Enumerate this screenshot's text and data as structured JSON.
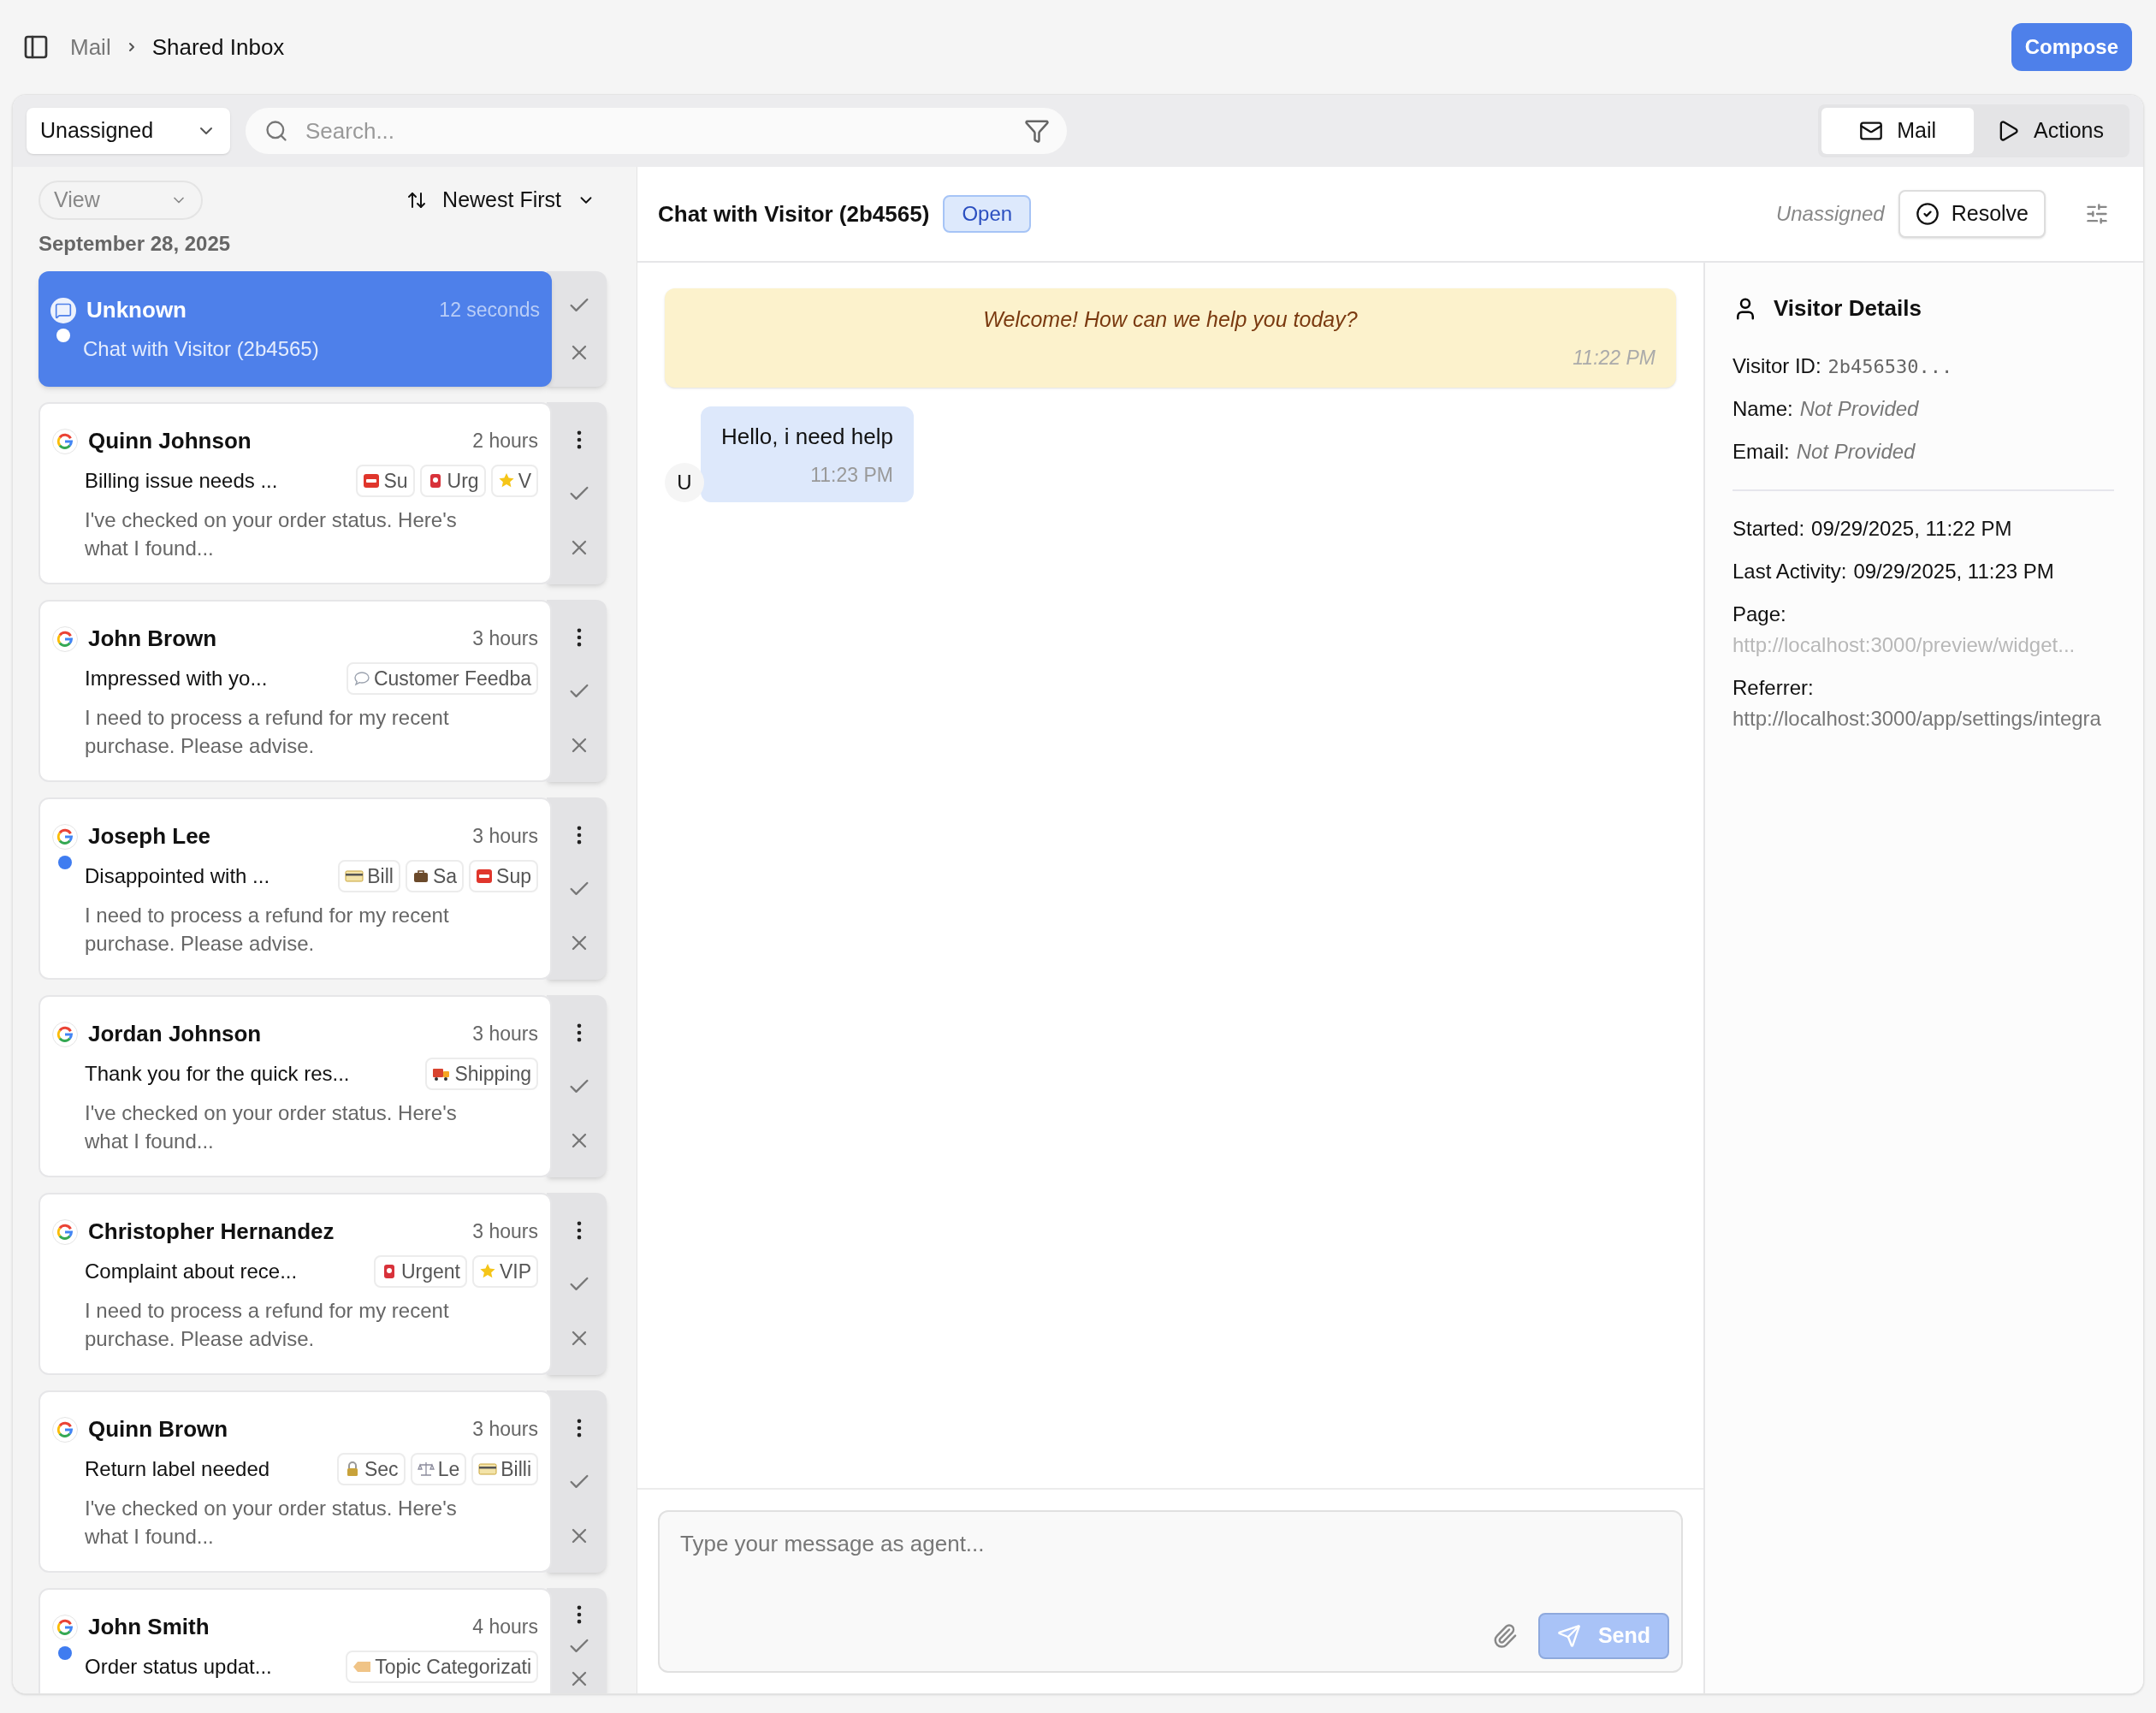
{
  "breadcrumb": [
    "Mail",
    "Shared Inbox"
  ],
  "compose": "Compose",
  "toolbar": {
    "assignee": "Unassigned",
    "search_placeholder": "Search...",
    "tabs": [
      {
        "label": "Mail",
        "kind": "mail",
        "selected": true
      },
      {
        "label": "Actions",
        "kind": "actions",
        "selected": false
      }
    ]
  },
  "list": {
    "view": "View",
    "sort": "Newest First",
    "date": "September 28, 2025",
    "items": [
      {
        "kind": "chat",
        "name": "Unknown",
        "time": "12 seconds",
        "subject": "Chat with Visitor (2b4565)",
        "unread": true,
        "selected": true
      },
      {
        "kind": "google",
        "name": "Quinn Johnson",
        "time": "2 hours",
        "subject": "Billing issue needs ...",
        "unread": false,
        "selected": false,
        "tags": [
          {
            "kind": "support",
            "label": "Su"
          },
          {
            "kind": "urgent",
            "label": "Urg"
          },
          {
            "kind": "vip",
            "label": "V"
          }
        ],
        "preview": "I've checked on your order status. Here's what I found..."
      },
      {
        "kind": "google",
        "name": "John Brown",
        "time": "3 hours",
        "subject": "Impressed with yo...",
        "unread": false,
        "selected": false,
        "tags": [
          {
            "kind": "feedback",
            "label": "Customer Feedba"
          }
        ],
        "preview": "I need to process a refund for my recent purchase. Please advise."
      },
      {
        "kind": "google",
        "name": "Joseph Lee",
        "time": "3 hours",
        "subject": "Disappointed with ...",
        "unread": true,
        "selected": false,
        "tags": [
          {
            "kind": "billing",
            "label": "Bill"
          },
          {
            "kind": "sales",
            "label": "Sa"
          },
          {
            "kind": "support",
            "label": "Sup"
          }
        ],
        "preview": "I need to process a refund for my recent purchase. Please advise."
      },
      {
        "kind": "google",
        "name": "Jordan Johnson",
        "time": "3 hours",
        "subject": "Thank you for the quick res...",
        "unread": false,
        "selected": false,
        "tags": [
          {
            "kind": "shipping",
            "label": "Shipping"
          }
        ],
        "preview": "I've checked on your order status. Here's what I found..."
      },
      {
        "kind": "google",
        "name": "Christopher Hernandez",
        "time": "3 hours",
        "subject": "Complaint about rece...",
        "unread": false,
        "selected": false,
        "tags": [
          {
            "kind": "urgent",
            "label": "Urgent"
          },
          {
            "kind": "vip",
            "label": "VIP"
          }
        ],
        "preview": "I need to process a refund for my recent purchase. Please advise."
      },
      {
        "kind": "google",
        "name": "Quinn Brown",
        "time": "3 hours",
        "subject": "Return label needed",
        "unread": false,
        "selected": false,
        "tags": [
          {
            "kind": "security",
            "label": "Sec"
          },
          {
            "kind": "legal",
            "label": "Le"
          },
          {
            "kind": "billing",
            "label": "Billi"
          }
        ],
        "preview": "I've checked on your order status. Here's what I found..."
      },
      {
        "kind": "google",
        "name": "John Smith",
        "time": "4 hours",
        "subject": "Order status updat...",
        "unread": true,
        "selected": false,
        "tags": [
          {
            "kind": "topic",
            "label": "Topic Categorizati"
          }
        ]
      }
    ]
  },
  "conversation": {
    "title": "Chat with Visitor (2b4565)",
    "status": "Open",
    "assignee": "Unassigned",
    "resolve": "Resolve",
    "messages": [
      {
        "kind": "system",
        "text": "Welcome! How can we help you today?",
        "time": "11:22 PM"
      },
      {
        "kind": "visitor",
        "avatar": "U",
        "text": "Hello, i need help",
        "time": "11:23 PM"
      }
    ],
    "composer": {
      "placeholder": "Type your message as agent...",
      "send": "Send",
      "send_disabled": true
    }
  },
  "visitor": {
    "title": "Visitor Details",
    "fields": [
      {
        "label": "Visitor ID:",
        "value": "2b456530...",
        "kind": "mono"
      },
      {
        "label": "Name:",
        "value": "Not Provided",
        "kind": "missing"
      },
      {
        "label": "Email:",
        "value": "Not Provided",
        "kind": "missing"
      }
    ],
    "activity": [
      {
        "label": "Started:",
        "value": "09/29/2025, 11:22 PM",
        "kind": "inline"
      },
      {
        "label": "Last Activity:",
        "value": "09/29/2025, 11:23 PM",
        "kind": "inline"
      },
      {
        "label": "Page:",
        "value": "http://localhost:3000/preview/widget...",
        "kind": "faint"
      },
      {
        "label": "Referrer:",
        "value": "http://localhost:3000/app/settings/integra",
        "kind": "link"
      }
    ]
  }
}
